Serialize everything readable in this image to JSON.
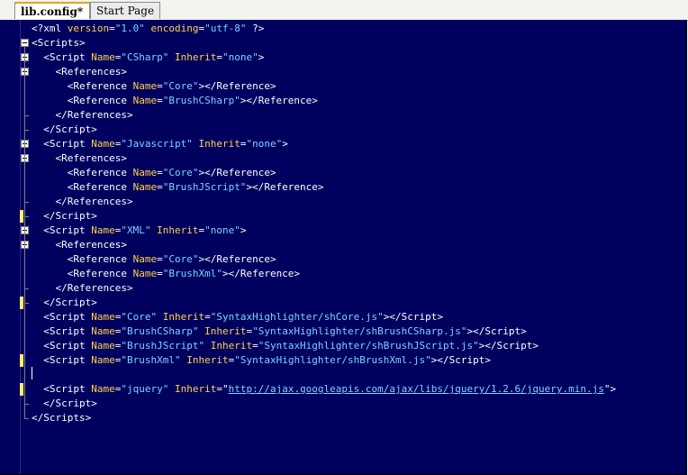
{
  "tabs": [
    {
      "label": "lib.config*",
      "active": true
    },
    {
      "label": "Start Page",
      "active": false
    }
  ],
  "editor": {
    "lines": [
      [
        [
          "brk",
          "<?"
        ],
        [
          "el",
          "xml"
        ],
        [
          "brk",
          " "
        ],
        [
          "attr",
          "version"
        ],
        [
          "brk",
          "="
        ],
        [
          "val",
          "\"1.0\""
        ],
        [
          "brk",
          " "
        ],
        [
          "attr",
          "encoding"
        ],
        [
          "brk",
          "="
        ],
        [
          "val",
          "\"utf-8\""
        ],
        [
          "brk",
          " ?>"
        ]
      ],
      [
        [
          "brk",
          "<"
        ],
        [
          "el",
          "Scripts"
        ],
        [
          "brk",
          ">"
        ]
      ],
      [
        [
          "brk",
          "  <"
        ],
        [
          "el",
          "Script"
        ],
        [
          "brk",
          " "
        ],
        [
          "attr",
          "Name"
        ],
        [
          "brk",
          "="
        ],
        [
          "val",
          "\"CSharp\""
        ],
        [
          "brk",
          " "
        ],
        [
          "attr",
          "Inherit"
        ],
        [
          "brk",
          "="
        ],
        [
          "val",
          "\"none\""
        ],
        [
          "brk",
          ">"
        ]
      ],
      [
        [
          "brk",
          "    <"
        ],
        [
          "el",
          "References"
        ],
        [
          "brk",
          ">"
        ]
      ],
      [
        [
          "brk",
          "      <"
        ],
        [
          "el",
          "Reference"
        ],
        [
          "brk",
          " "
        ],
        [
          "attr",
          "Name"
        ],
        [
          "brk",
          "="
        ],
        [
          "val",
          "\"Core\""
        ],
        [
          "brk",
          "></"
        ],
        [
          "el",
          "Reference"
        ],
        [
          "brk",
          ">"
        ]
      ],
      [
        [
          "brk",
          "      <"
        ],
        [
          "el",
          "Reference"
        ],
        [
          "brk",
          " "
        ],
        [
          "attr",
          "Name"
        ],
        [
          "brk",
          "="
        ],
        [
          "val",
          "\"BrushCSharp\""
        ],
        [
          "brk",
          "></"
        ],
        [
          "el",
          "Reference"
        ],
        [
          "brk",
          ">"
        ]
      ],
      [
        [
          "brk",
          "    </"
        ],
        [
          "el",
          "References"
        ],
        [
          "brk",
          ">"
        ]
      ],
      [
        [
          "brk",
          "  </"
        ],
        [
          "el",
          "Script"
        ],
        [
          "brk",
          ">"
        ]
      ],
      [
        [
          "brk",
          "  <"
        ],
        [
          "el",
          "Script"
        ],
        [
          "brk",
          " "
        ],
        [
          "attr",
          "Name"
        ],
        [
          "brk",
          "="
        ],
        [
          "val",
          "\"Javascript\""
        ],
        [
          "brk",
          " "
        ],
        [
          "attr",
          "Inherit"
        ],
        [
          "brk",
          "="
        ],
        [
          "val",
          "\"none\""
        ],
        [
          "brk",
          ">"
        ]
      ],
      [
        [
          "brk",
          "    <"
        ],
        [
          "el",
          "References"
        ],
        [
          "brk",
          ">"
        ]
      ],
      [
        [
          "brk",
          "      <"
        ],
        [
          "el",
          "Reference"
        ],
        [
          "brk",
          " "
        ],
        [
          "attr",
          "Name"
        ],
        [
          "brk",
          "="
        ],
        [
          "val",
          "\"Core\""
        ],
        [
          "brk",
          "></"
        ],
        [
          "el",
          "Reference"
        ],
        [
          "brk",
          ">"
        ]
      ],
      [
        [
          "brk",
          "      <"
        ],
        [
          "el",
          "Reference"
        ],
        [
          "brk",
          " "
        ],
        [
          "attr",
          "Name"
        ],
        [
          "brk",
          "="
        ],
        [
          "val",
          "\"BrushJScript\""
        ],
        [
          "brk",
          "></"
        ],
        [
          "el",
          "Reference"
        ],
        [
          "brk",
          ">"
        ]
      ],
      [
        [
          "brk",
          "    </"
        ],
        [
          "el",
          "References"
        ],
        [
          "brk",
          ">"
        ]
      ],
      [
        [
          "brk",
          "  </"
        ],
        [
          "el",
          "Script"
        ],
        [
          "brk",
          ">"
        ]
      ],
      [
        [
          "brk",
          "  <"
        ],
        [
          "el",
          "Script"
        ],
        [
          "brk",
          " "
        ],
        [
          "attr",
          "Name"
        ],
        [
          "brk",
          "="
        ],
        [
          "val",
          "\"XML\""
        ],
        [
          "brk",
          " "
        ],
        [
          "attr",
          "Inherit"
        ],
        [
          "brk",
          "="
        ],
        [
          "val",
          "\"none\""
        ],
        [
          "brk",
          ">"
        ]
      ],
      [
        [
          "brk",
          "    <"
        ],
        [
          "el",
          "References"
        ],
        [
          "brk",
          ">"
        ]
      ],
      [
        [
          "brk",
          "      <"
        ],
        [
          "el",
          "Reference"
        ],
        [
          "brk",
          " "
        ],
        [
          "attr",
          "Name"
        ],
        [
          "brk",
          "="
        ],
        [
          "val",
          "\"Core\""
        ],
        [
          "brk",
          "></"
        ],
        [
          "el",
          "Reference"
        ],
        [
          "brk",
          ">"
        ]
      ],
      [
        [
          "brk",
          "      <"
        ],
        [
          "el",
          "Reference"
        ],
        [
          "brk",
          " "
        ],
        [
          "attr",
          "Name"
        ],
        [
          "brk",
          "="
        ],
        [
          "val",
          "\"BrushXml\""
        ],
        [
          "brk",
          "></"
        ],
        [
          "el",
          "Reference"
        ],
        [
          "brk",
          ">"
        ]
      ],
      [
        [
          "brk",
          "    </"
        ],
        [
          "el",
          "References"
        ],
        [
          "brk",
          ">"
        ]
      ],
      [
        [
          "brk",
          "  </"
        ],
        [
          "el",
          "Script"
        ],
        [
          "brk",
          ">"
        ]
      ],
      [
        [
          "brk",
          "  <"
        ],
        [
          "el",
          "Script"
        ],
        [
          "brk",
          " "
        ],
        [
          "attr",
          "Name"
        ],
        [
          "brk",
          "="
        ],
        [
          "val",
          "\"Core\""
        ],
        [
          "brk",
          " "
        ],
        [
          "attr",
          "Inherit"
        ],
        [
          "brk",
          "="
        ],
        [
          "val",
          "\"SyntaxHighlighter/shCore.js\""
        ],
        [
          "brk",
          "></"
        ],
        [
          "el",
          "Script"
        ],
        [
          "brk",
          ">"
        ]
      ],
      [
        [
          "brk",
          "  <"
        ],
        [
          "el",
          "Script"
        ],
        [
          "brk",
          " "
        ],
        [
          "attr",
          "Name"
        ],
        [
          "brk",
          "="
        ],
        [
          "val",
          "\"BrushCSharp\""
        ],
        [
          "brk",
          " "
        ],
        [
          "attr",
          "Inherit"
        ],
        [
          "brk",
          "="
        ],
        [
          "val",
          "\"SyntaxHighlighter/shBrushCSharp.js\""
        ],
        [
          "brk",
          "></"
        ],
        [
          "el",
          "Script"
        ],
        [
          "brk",
          ">"
        ]
      ],
      [
        [
          "brk",
          "  <"
        ],
        [
          "el",
          "Script"
        ],
        [
          "brk",
          " "
        ],
        [
          "attr",
          "Name"
        ],
        [
          "brk",
          "="
        ],
        [
          "val",
          "\"BrushJScript\""
        ],
        [
          "brk",
          " "
        ],
        [
          "attr",
          "Inherit"
        ],
        [
          "brk",
          "="
        ],
        [
          "val",
          "\"SyntaxHighlighter/shBrushJScript.js\""
        ],
        [
          "brk",
          "></"
        ],
        [
          "el",
          "Script"
        ],
        [
          "brk",
          ">"
        ]
      ],
      [
        [
          "brk",
          "  <"
        ],
        [
          "el",
          "Script"
        ],
        [
          "brk",
          " "
        ],
        [
          "attr",
          "Name"
        ],
        [
          "brk",
          "="
        ],
        [
          "val",
          "\"BrushXml\""
        ],
        [
          "brk",
          " "
        ],
        [
          "attr",
          "Inherit"
        ],
        [
          "brk",
          "="
        ],
        [
          "val",
          "\"SyntaxHighlighter/shBrushXml.js\""
        ],
        [
          "brk",
          "></"
        ],
        [
          "el",
          "Script"
        ],
        [
          "brk",
          ">"
        ]
      ],
      [],
      [
        [
          "brk",
          "  <"
        ],
        [
          "el",
          "Script"
        ],
        [
          "brk",
          " "
        ],
        [
          "attr",
          "Name"
        ],
        [
          "brk",
          "="
        ],
        [
          "val",
          "\"jquery\""
        ],
        [
          "brk",
          " "
        ],
        [
          "attr",
          "Inherit"
        ],
        [
          "brk",
          "=\""
        ],
        [
          "url",
          "http://ajax.googleapis.com/ajax/libs/jquery/1.2.6/jquery.min.js"
        ],
        [
          "brk",
          "\">"
        ]
      ],
      [
        [
          "brk",
          "  </"
        ],
        [
          "el",
          "Script"
        ],
        [
          "brk",
          ">"
        ]
      ],
      [
        [
          "brk",
          "</"
        ],
        [
          "el",
          "Scripts"
        ],
        [
          "brk",
          ">"
        ]
      ]
    ]
  },
  "colors": {
    "editor_background": "#00005f",
    "attribute_name": "#ffd34a",
    "attribute_value": "#7cd3ff",
    "markup": "#ffffff",
    "change_marker": "#ffef6b"
  }
}
